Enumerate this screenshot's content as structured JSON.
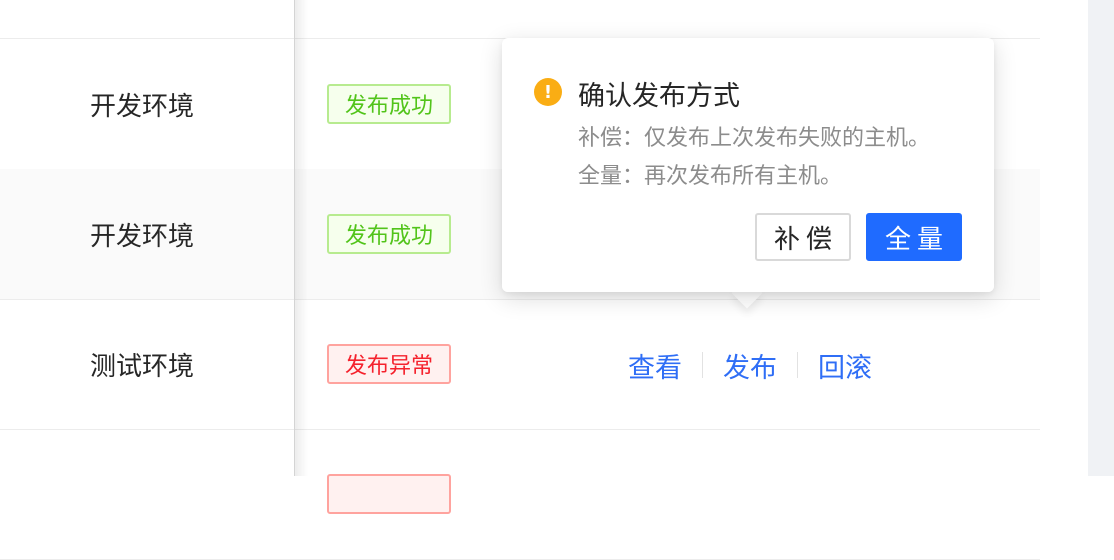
{
  "rows": [
    {
      "env": "开发环境",
      "status": "发布成功"
    },
    {
      "env": "开发环境",
      "status": "发布成功"
    },
    {
      "env": "测试环境",
      "status": "发布异常"
    }
  ],
  "actions": {
    "view": "查看",
    "publish": "发布",
    "rollback": "回滚"
  },
  "popover": {
    "title": "确认发布方式",
    "icon": "!",
    "desc_compensate": "补偿：仅发布上次发布失败的主机。",
    "desc_full": "全量：再次发布所有主机。",
    "compensate_button": "补偿",
    "full_button": "全量"
  },
  "colors": {
    "success": "#52c41a",
    "error": "#f5222d",
    "link": "#2f6ef6",
    "primary": "#1f6bff",
    "warning": "#faad14"
  }
}
